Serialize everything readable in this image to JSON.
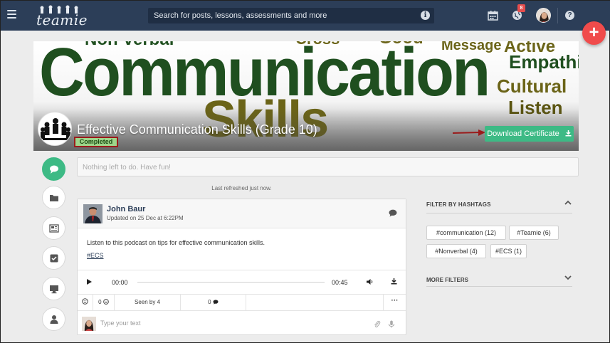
{
  "nav": {
    "logo_text": "teamie",
    "search_placeholder": "Search for posts, lessons, assessments and more",
    "notification_count": "8"
  },
  "banner": {
    "words": {
      "nonverbal": "Non-verbal",
      "cross": "Cross",
      "good": "Good",
      "message": "Message",
      "active": "Active",
      "communication": "Communication",
      "empathic": "Empathic",
      "cultural": "Cultural",
      "skills": "Skills",
      "listen": "Listen"
    },
    "course_title": "Effective Communication Skills (Grade 10)",
    "status": "Completed",
    "download_label": "Download Certificate"
  },
  "todo": {
    "text": "Nothing left to do. Have fun!"
  },
  "refreshed": "Last refreshed just now.",
  "post": {
    "author": "John Baur",
    "updated": "Updated on 25 Dec at 6:22PM",
    "body": "Listen to this podcast on tips for effective communication skills.",
    "hashtag": "#ECS",
    "player": {
      "start": "00:00",
      "end": "00:45"
    },
    "stats": {
      "reactions": "0",
      "seen": "Seen by 4",
      "comments": "0"
    },
    "comment_placeholder": "Type your text"
  },
  "filters": {
    "title": "FILTER BY HASHTAGS",
    "tags": [
      {
        "label": "#communication (12)"
      },
      {
        "label": "#Teamie (6)"
      },
      {
        "label": "#Nonverbal (4)"
      },
      {
        "label": "#ECS (1)"
      }
    ],
    "more_title": "MORE FILTERS"
  },
  "colors": {
    "nav": "#2c3e58",
    "accent": "#3dba85",
    "fab": "#f04b4b",
    "word_green": "#1f4f1f",
    "word_olive": "#6b6418"
  }
}
